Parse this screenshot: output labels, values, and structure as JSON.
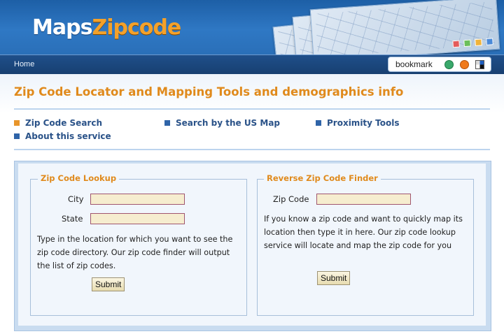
{
  "header": {
    "logo_maps": "Maps",
    "logo_zipcode": "Zipcode"
  },
  "nav": {
    "home": "Home",
    "bookmark_label": "bookmark",
    "bookmark_icons": [
      "share-icon",
      "feed-icon",
      "delicious-icon"
    ]
  },
  "page": {
    "title": "Zip Code Locator and Mapping Tools and demographics info"
  },
  "links": [
    {
      "label": "Zip Code Search",
      "bullet": "#e8952a"
    },
    {
      "label": "Search by the US Map",
      "bullet": "#2f64a8"
    },
    {
      "label": "Proximity Tools",
      "bullet": "#2f64a8"
    },
    {
      "label": "About this service",
      "bullet": "#2f64a8"
    }
  ],
  "lookup": {
    "legend": "Zip Code Lookup",
    "city_label": "City",
    "city_value": "",
    "state_label": "State",
    "state_value": "",
    "description": "Type in the location for which you want to see the zip code directory. Our zip code finder will output the list of zip codes.",
    "submit": "Submit"
  },
  "reverse": {
    "legend": "Reverse Zip Code Finder",
    "zip_label": "Zip Code",
    "zip_value": "",
    "description": "If you know a zip code and want to quickly map its location then type it in here. Our zip code lookup service will locate and map the zip code for you",
    "submit": "Submit"
  },
  "colors": {
    "header_blue": "#2f78c4",
    "accent_orange": "#e08a1c",
    "link_blue": "#2a5288",
    "input_fill": "#f6edcf"
  }
}
